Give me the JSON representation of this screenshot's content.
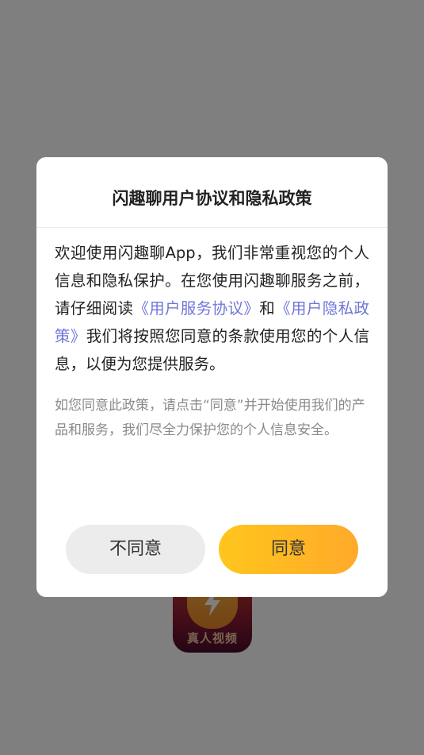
{
  "splash": {
    "app_icon_label": "真人视频"
  },
  "dialog": {
    "title": "闪趣聊用户协议和隐私政策",
    "body": {
      "part1": "欢迎使用闪趣聊App，我们非常重视您的个人信息和隐私保护。在您使用闪趣聊服务之前，请仔细阅读",
      "link_service": "《用户服务协议》",
      "part2": "和",
      "link_privacy": "《用户隐私政策》",
      "part3": "我们将按照您同意的条款使用您的个人信息，以便为您提供服务。"
    },
    "note": "如您同意此政策，请点击“同意”并开始使用我们的产品和服务，我们尽全力保护您的个人信息安全。",
    "buttons": {
      "disagree": "不同意",
      "agree": "同意"
    }
  },
  "colors": {
    "link": "#6f76d9",
    "agree_gradient_start": "#ffc61c",
    "agree_gradient_end": "#ffaa2a",
    "disagree_bg": "#ececec",
    "overlay": "rgba(0,0,0,0.5)"
  }
}
